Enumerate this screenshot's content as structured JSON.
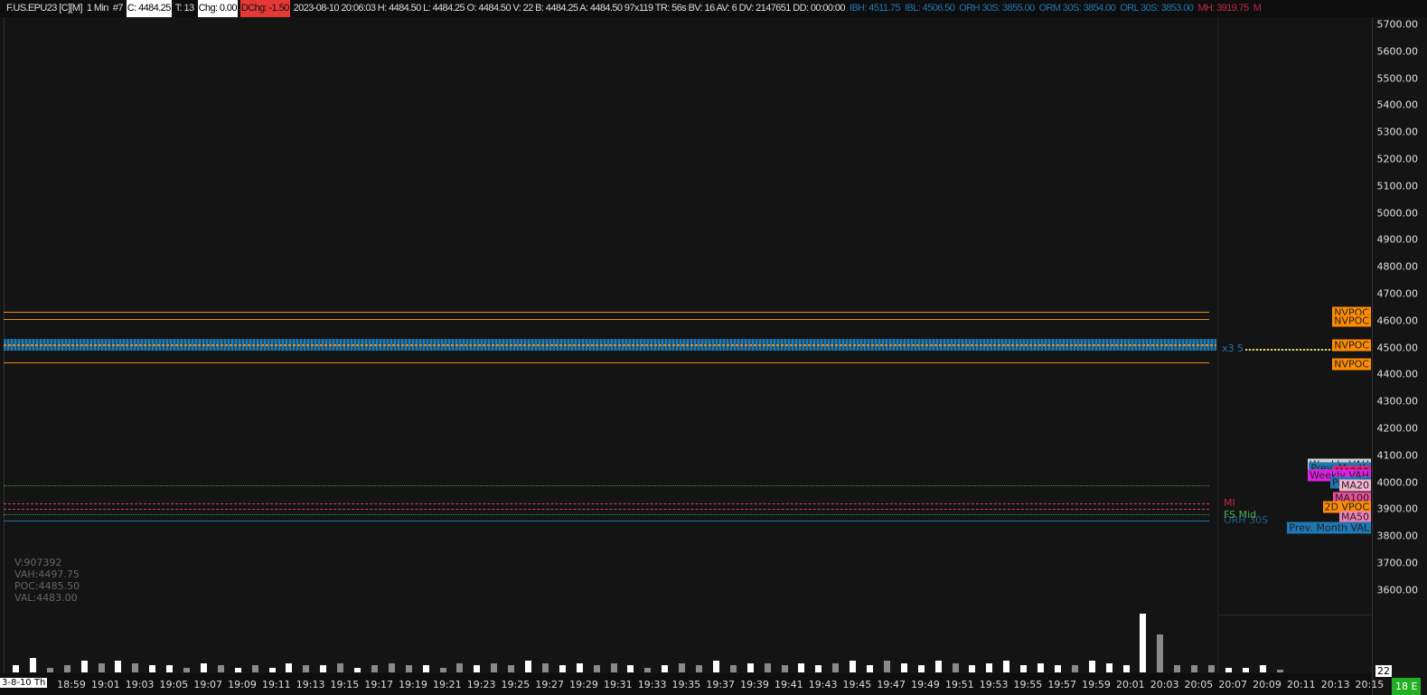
{
  "header": {
    "symbol": "F.US.EPU23 [C][M]",
    "interval": "1 Min",
    "chart_no": "#7",
    "close": "C: 4484.25",
    "trades": "T: 13",
    "chg": "Chg: 0.00",
    "dchg": "DChg: -1.50",
    "info": "2023-08-10 20:06:03 H: 4484.50 L: 4484.25 O: 4484.50 V: 22 B: 4484.25 A: 4484.50 97x119 TR: 56s BV: 16 AV: 6 DV: 2147651 DD: 00:00:00",
    "ibh": "IBH: 4511.75",
    "ibl": "IBL: 4506.50",
    "orh": "ORH 30S: 3855.00",
    "orm": "ORM 30S: 3854.00",
    "orl": "ORL 30S: 3853.00",
    "mh": "MH: 3919.75",
    "m": "M"
  },
  "price_axis": [
    "5700.00",
    "5600.00",
    "5500.00",
    "5400.00",
    "5300.00",
    "5200.00",
    "5100.00",
    "5000.00",
    "4900.00",
    "4800.00",
    "4700.00",
    "4600.00",
    "4500.00",
    "4400.00",
    "4300.00",
    "4200.00",
    "4100.00",
    "4000.00",
    "3900.00",
    "3800.00",
    "3700.00",
    "3600.00"
  ],
  "levels": [
    {
      "name": "NVPOC",
      "price": "4630.00",
      "p": 4630,
      "bg": "#ff8c00",
      "bg2": "#ff8c00"
    },
    {
      "name": "NVPOC",
      "price": "4601.00",
      "p": 4601,
      "bg": "#ff8c00",
      "bg2": "#ff8c00"
    },
    {
      "name": "NVPOC",
      "price": "",
      "p": 4510,
      "bg": "#ff8c00",
      "bg2": "#1f77b4"
    },
    {
      "name": "NVPOC",
      "price": "4438.00",
      "p": 4438,
      "bg": "#ff8c00",
      "bg2": "#ff8c00"
    },
    {
      "name": "Weekly VAH",
      "price": "4067.50",
      "p": 4067,
      "bg": "#d0d0d0",
      "bg2": "#d0d0d0"
    },
    {
      "name": "Prev. Month",
      "price": "",
      "p": 4053,
      "bg": "#1f77b4",
      "bg2": "#1f77b4"
    },
    {
      "name": "MA200",
      "price": "4039.55",
      "p": 4039.5,
      "bg": "#e91e7a",
      "bg2": "#e91e7a"
    },
    {
      "name": "Weekly VAH",
      "price": "4026.00",
      "p": 4025,
      "bg": "#e020e0",
      "bg2": "#e020e0"
    },
    {
      "name": "Prev. W",
      "price": "",
      "p": 3998,
      "bg": "#1f77b4",
      "bg2": "#1f77b4"
    },
    {
      "name": "MA20",
      "price": "3987.30",
      "p": 3987.3,
      "bg": "#f5b3d0",
      "bg2": "#f5b3d0"
    },
    {
      "name": "MA100",
      "price": "3941.82",
      "p": 3941.8,
      "bg": "#e94e9a",
      "bg2": "#e94e9a"
    },
    {
      "name": "2D VPOC",
      "price": "3907.75",
      "p": 3907.75,
      "bg": "#ff8c00",
      "bg2": "#ff8c00"
    },
    {
      "name": "MA50",
      "price": "3871.85",
      "p": 3871.85,
      "bg": "#f081b8",
      "bg2": "#f081b8"
    },
    {
      "name": "Prev. Month VAL",
      "price": "3830.00",
      "p": 3830,
      "bg": "#1f77b4",
      "bg2": "#1f77b4"
    }
  ],
  "last_price": "4484.25",
  "line_labels": {
    "x3": "x3 5",
    "mi": "MI",
    "fs_mid": "FS Mid",
    "orh": "ORH 30S"
  },
  "stats": {
    "v": "V:907392",
    "vah": "VAH:4497.75",
    "poc": "POC:4485.50",
    "val": "VAL:4483.00"
  },
  "date_label": "3-8-10 Th",
  "time_labels": [
    "18:59",
    "19:01",
    "19:03",
    "19:05",
    "19:07",
    "19:09",
    "19:11",
    "19:13",
    "19:15",
    "19:17",
    "19:19",
    "19:21",
    "19:23",
    "19:25",
    "19:27",
    "19:29",
    "19:31",
    "19:33",
    "19:35",
    "19:37",
    "19:39",
    "19:41",
    "19:43",
    "19:45",
    "19:47",
    "19:49",
    "19:51",
    "19:53",
    "19:55",
    "19:57",
    "19:59",
    "20:01",
    "20:03",
    "20:05",
    "20:07",
    "20:09",
    "20:11",
    "20:13",
    "20:15"
  ],
  "volume_label": "22",
  "bar_timer": "18 E",
  "volumes": [
    3,
    6,
    2,
    3,
    5,
    4,
    5,
    4,
    3,
    3,
    2,
    4,
    3,
    2,
    3,
    2,
    4,
    3,
    3,
    4,
    2,
    3,
    4,
    3,
    3,
    2,
    4,
    3,
    4,
    3,
    5,
    4,
    3,
    4,
    3,
    4,
    3,
    2,
    3,
    4,
    3,
    5,
    3,
    4,
    4,
    3,
    4,
    3,
    4,
    5,
    3,
    5,
    4,
    3,
    5,
    4,
    3,
    4,
    5,
    3,
    4,
    3,
    3,
    5,
    4,
    3,
    25,
    16,
    3,
    3,
    3,
    2,
    2,
    3,
    1
  ],
  "volume_up": [
    1,
    1,
    0,
    0,
    1,
    0,
    1,
    0,
    1,
    1,
    0,
    1,
    0,
    1,
    0,
    1,
    1,
    0,
    1,
    0,
    1,
    0,
    0,
    0,
    1,
    0,
    0,
    1,
    0,
    0,
    1,
    0,
    1,
    1,
    0,
    0,
    1,
    0,
    1,
    0,
    0,
    1,
    0,
    1,
    0,
    0,
    1,
    1,
    0,
    1,
    1,
    0,
    1,
    1,
    1,
    0,
    1,
    1,
    1,
    1,
    1,
    1,
    0,
    1,
    1,
    1,
    1,
    0,
    0,
    0,
    0,
    1,
    1,
    1,
    0
  ]
}
